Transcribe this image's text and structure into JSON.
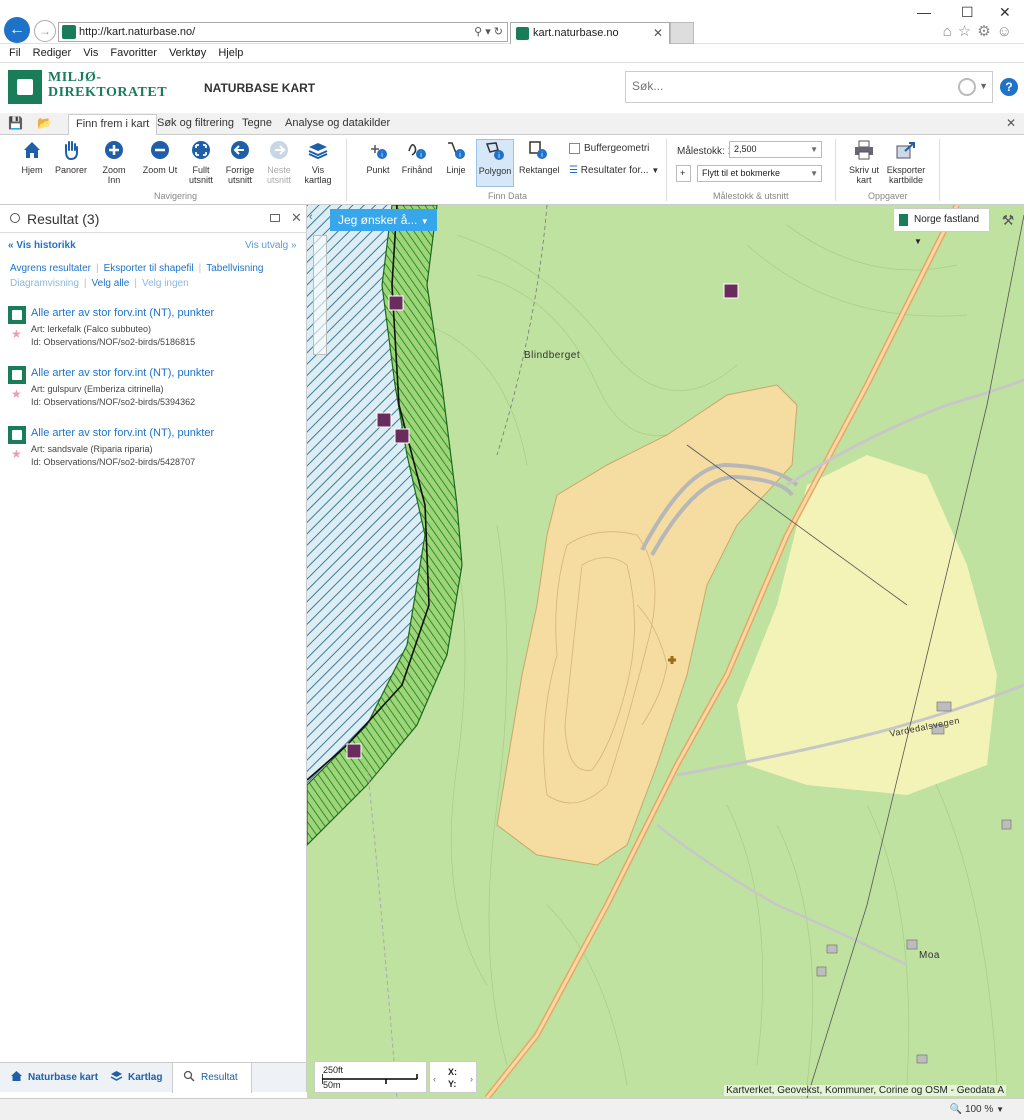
{
  "browser": {
    "url": "http://kart.naturbase.no/",
    "tab_title": "kart.naturbase.no",
    "menu": [
      "Fil",
      "Rediger",
      "Vis",
      "Favoritter",
      "Verktøy",
      "Hjelp"
    ],
    "zoom": "100 %"
  },
  "header": {
    "logo_line1": "MILJØ-",
    "logo_line2": "DIREKTORATET",
    "app_title": "NATURBASE KART",
    "search_placeholder": "Søk..."
  },
  "ribbon": {
    "tabs": [
      "Finn frem i kart",
      "Søk og filtrering",
      "Tegne",
      "Analyse og datakilder"
    ],
    "nav_buttons": [
      "Hjem",
      "Panorer",
      "Zoom Inn",
      "Zoom Ut",
      "Fullt utsnitt",
      "Forrige utsnitt",
      "Neste utsnitt",
      "Vis kartlag"
    ],
    "nav_group": "Navigering",
    "find_buttons": [
      "Punkt",
      "Frihånd",
      "Linje",
      "Polygon",
      "Rektangel"
    ],
    "buffer_label": "Buffergeometri",
    "results_for_label": "Resultater for...",
    "find_group": "Finn Data",
    "scale_label": "Målestokk: 1:",
    "scale_value": "2,500",
    "move_bookmark": "Flytt til et bokmerke",
    "scale_group": "Målestokk & utsnitt",
    "print_label": "Skriv ut kart",
    "export_label": "Eksporter kartbilde",
    "tasks_group": "Oppgaver"
  },
  "panel": {
    "title": "Resultat (3)",
    "history": "Vis historikk",
    "selection": "Vis utvalg",
    "actions": {
      "limit": "Avgrens resultater",
      "export_shape": "Eksporter til shapefil",
      "table_view": "Tabellvisning",
      "diagram_view": "Diagramvisning",
      "select_all": "Velg alle",
      "select_none": "Velg ingen"
    },
    "results": [
      {
        "title": "Alle arter av stor forv.int (NT), punkter",
        "species": "Art: lerkefalk (Falco subbuteo)",
        "id": "Id: Observations/NOF/so2-birds/5186815"
      },
      {
        "title": "Alle arter av stor forv.int (NT), punkter",
        "species": "Art: gulspurv (Emberiza citrinella)",
        "id": "Id: Observations/NOF/so2-birds/5394362"
      },
      {
        "title": "Alle arter av stor forv.int (NT), punkter",
        "species": "Art: sandsvale (Riparia riparia)",
        "id": "Id: Observations/NOF/so2-birds/5428707"
      }
    ],
    "bottom_tabs": [
      "Naturbase kart",
      "Kartlag",
      "Resultat (3)"
    ]
  },
  "map": {
    "action_button": "Jeg ønsker å...",
    "region": "Norge fastland",
    "place_blindberget": "Blindberget",
    "place_moa": "Moa",
    "road_vardedalsvegen": "Vardedalsvegen",
    "scale_ft": "250ft",
    "scale_m": "50m",
    "coord_x": "X:",
    "coord_y": "Y:",
    "attribution": "Kartverket, Geovekst, Kommuner, Corine og OSM - Geodata A"
  },
  "colors": {
    "brand_green": "#1a7d5a",
    "link_blue": "#1e73c9",
    "map_green": "#bfe2a0",
    "quarry_sand": "#f5dca0",
    "marker_purple": "#6a2c5c"
  }
}
